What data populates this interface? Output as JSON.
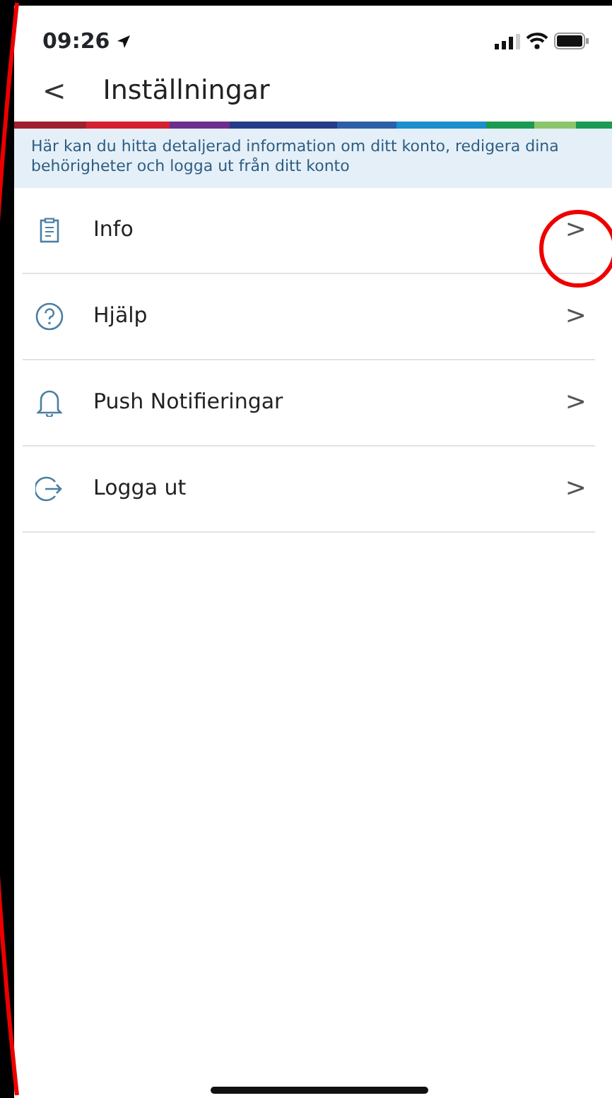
{
  "status_bar": {
    "time": "09:26"
  },
  "header": {
    "back": "<",
    "title": "Inställningar"
  },
  "banner": "Här kan du hitta detaljerad information om ditt konto, redigera dina behörigheter och logga ut från ditt konto",
  "menu": [
    {
      "kind": "clipboard",
      "label": "Info",
      "chevron": ">"
    },
    {
      "kind": "help",
      "label": "Hjälp",
      "chevron": ">"
    },
    {
      "kind": "bell",
      "label": "Push Notifieringar",
      "chevron": ">"
    },
    {
      "kind": "logout",
      "label": "Logga ut",
      "chevron": ">"
    }
  ]
}
